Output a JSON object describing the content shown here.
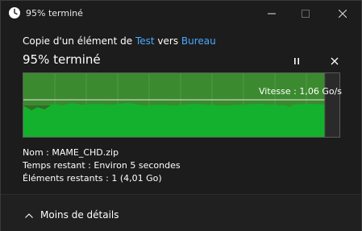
{
  "window": {
    "title": "95% terminé",
    "icons": {
      "app": "clock-icon",
      "minimize": "minimize-icon",
      "maximize": "maximize-icon",
      "close": "close-icon"
    }
  },
  "header": {
    "copy_prefix": "Copie d'un élément de",
    "source": "Test",
    "connector": "vers",
    "destination": "Bureau",
    "progress_title": "95% terminé",
    "pause_icon": "pause-icon",
    "cancel_icon": "close-icon"
  },
  "progress": {
    "percent": 95,
    "speed_label": "Vitesse : 1,06 Go/s",
    "colors": {
      "fill": "#13b12d",
      "history": "#3c8a30",
      "track": "#2a2a2a"
    }
  },
  "details": {
    "name_label": "Nom :",
    "name_value": "MAME_CHD.zip",
    "time_label": "Temps restant :",
    "time_value": "Environ 5 secondes",
    "items_label": "Éléments restants :",
    "items_value": "1 (4,01 Go)"
  },
  "footer": {
    "toggle_label": "Moins de détails",
    "toggle_icon": "chevron-up-icon"
  }
}
